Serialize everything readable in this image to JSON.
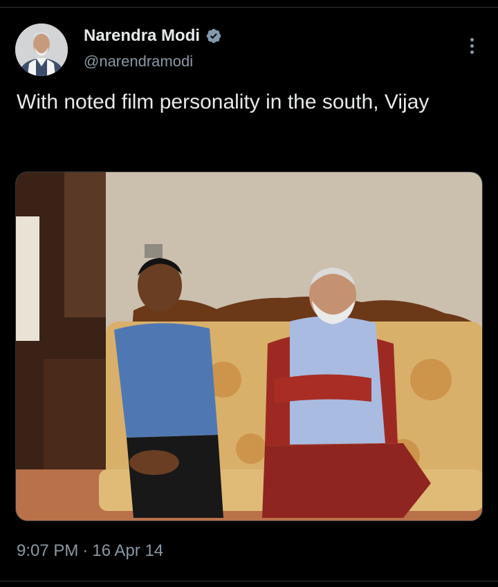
{
  "tweet": {
    "author": {
      "display_name": "Narendra Modi",
      "handle": "@narendramodi",
      "verified": true,
      "verified_badge_color": "#829aab",
      "avatar_icon": "profile-photo"
    },
    "text": "With noted film personality in the south, Vijay",
    "media": {
      "type": "photo"
    },
    "time": "9:07 PM",
    "separator": "·",
    "date": "16 Apr 14",
    "more_icon": "more-vertical-icon"
  },
  "colors": {
    "background": "#000000",
    "primary_text": "#e7e9ea",
    "secondary_text": "#8b98a5",
    "divider": "#2f3336"
  }
}
